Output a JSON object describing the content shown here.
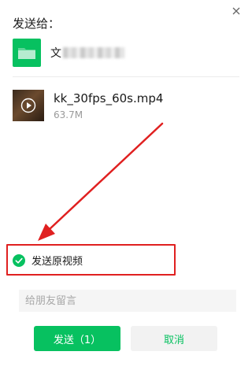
{
  "colors": {
    "accent": "#07c160",
    "annotation": "#e02020"
  },
  "dialog": {
    "title": "发送给：",
    "close_icon": "close-icon"
  },
  "recipient": {
    "avatar_icon": "folder-icon",
    "name_visible": "文"
  },
  "file": {
    "name": "kk_30fps_60s.mp4",
    "size": "63.7M",
    "thumbnail_icon": "play-icon"
  },
  "option": {
    "label": "发送原视频",
    "checked": true,
    "icon": "check-circle-icon"
  },
  "message": {
    "placeholder": "给朋友留言"
  },
  "buttons": {
    "send": "发送（1）",
    "cancel": "取消"
  }
}
